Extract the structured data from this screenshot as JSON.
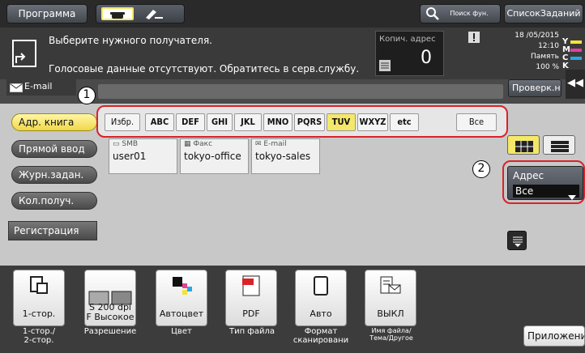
{
  "top": {
    "program": "Программа",
    "search": "Поиск фун.",
    "job_list": "СписокЗаданий"
  },
  "info": {
    "message1": "Выберите нужного получателя.",
    "message2": "Голосовые данные отсутствуют. Обратитесь в серв.службу.",
    "copies_label": "Копич. адрес",
    "copies_value": "0",
    "date": "18 /05/2015",
    "time": "12:10",
    "memory_label": "Память",
    "memory_value": "100 %"
  },
  "email_tab": "E-mail",
  "check_button": "Проверк.н",
  "side": {
    "address_book": "Адр. книга",
    "direct_input": "Прямой ввод",
    "job_log": "Журн.задан.",
    "multi_dest": "Кол.получ.",
    "registration": "Регистрация"
  },
  "filters": [
    "Избр.",
    "ABC",
    "DEF",
    "GHI",
    "JKL",
    "MNO",
    "PQRS",
    "TUV",
    "WXYZ",
    "etc",
    "Все"
  ],
  "entries": [
    {
      "type": "SMB",
      "name": "user01"
    },
    {
      "type": "Факс",
      "name": "tokyo-office"
    },
    {
      "type": "E-mail",
      "name": "tokyo-sales"
    }
  ],
  "address_filter": {
    "label": "Адрес",
    "value": "Все"
  },
  "callouts": [
    "1",
    "2"
  ],
  "functions": [
    {
      "value": "1-стор.",
      "label": "1-стор./\n2-стор."
    },
    {
      "value": "S 200 dpi\nF Высокое",
      "label": "Разрешение"
    },
    {
      "value": "Автоцвет",
      "label": "Цвет"
    },
    {
      "value": "PDF",
      "label": "Тип файла"
    },
    {
      "value": "Авто",
      "label": "Формат\nсканировани"
    },
    {
      "value": "ВЫКЛ",
      "label": "Имя файла/\nТема/Другое"
    }
  ],
  "app_button": "Приложение",
  "colors": {
    "highlight": "#f5e76a",
    "callout_red": "#d9222a"
  }
}
